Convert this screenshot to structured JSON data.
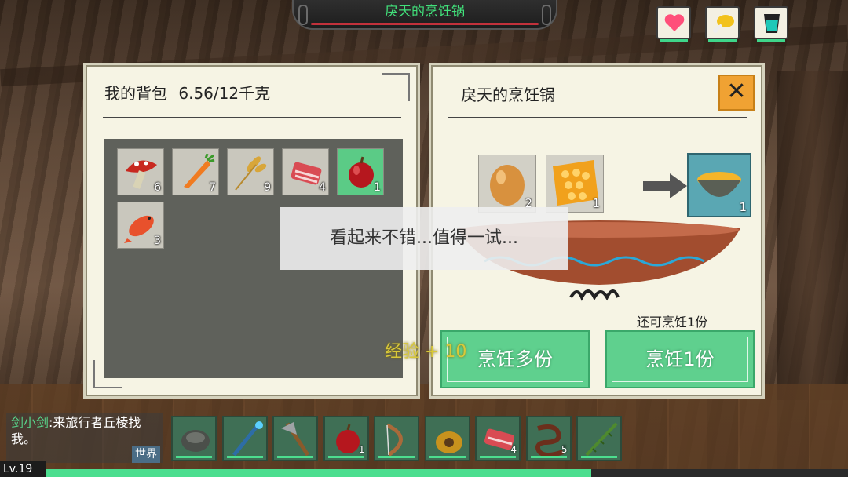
{
  "hud": {
    "title": "戾天的烹饪锅",
    "stats": [
      {
        "name": "health",
        "icon": "heart-icon",
        "color": "#ff4f7a"
      },
      {
        "name": "hunger",
        "icon": "drumstick-icon",
        "color": "#f2c21c"
      },
      {
        "name": "thirst",
        "icon": "water-glass-icon",
        "color": "#1ec8b8"
      }
    ]
  },
  "backpack": {
    "title": "我的背包",
    "weight": "6.56/12千克",
    "items": [
      {
        "name": "mushroom",
        "count": "6"
      },
      {
        "name": "carrot",
        "count": "7"
      },
      {
        "name": "wheat",
        "count": "9"
      },
      {
        "name": "raw-meat",
        "count": "4"
      },
      {
        "name": "apple",
        "count": "1",
        "selected": true
      },
      {
        "name": "fish",
        "count": "3"
      }
    ]
  },
  "cooking": {
    "title": "戾天的烹饪锅",
    "ingredients": [
      {
        "name": "egg",
        "count": "2"
      },
      {
        "name": "honeycomb",
        "count": "1"
      }
    ],
    "result": {
      "name": "porridge",
      "count": "1"
    },
    "remaining_text": "还可烹饪1份",
    "cook_multi_label": "烹饪多份",
    "cook_one_label": "烹饪1份",
    "close_label": "✕"
  },
  "toast": "看起来不错...值得一试...",
  "exp_text": "经验 + 10",
  "chat": {
    "name": "剑小剑",
    "message": ":来旅行者丘棱找我。",
    "world_label": "世界"
  },
  "hotbar": [
    {
      "name": "stone",
      "count": ""
    },
    {
      "name": "magic-staff",
      "count": ""
    },
    {
      "name": "axe",
      "count": ""
    },
    {
      "name": "apple",
      "count": "1"
    },
    {
      "name": "bow",
      "count": ""
    },
    {
      "name": "water-bag",
      "count": ""
    },
    {
      "name": "raw-meat",
      "count": "4"
    },
    {
      "name": "earthworm",
      "count": "5"
    },
    {
      "name": "bamboo-spear",
      "count": ""
    }
  ],
  "level": "Lv.19",
  "xp_fraction": 0.68
}
